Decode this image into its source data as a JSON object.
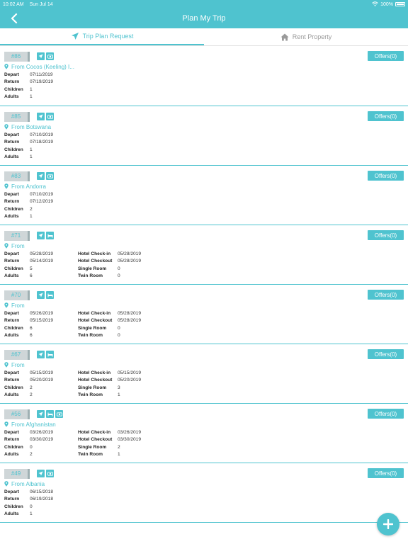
{
  "status_bar": {
    "time": "10:02 AM",
    "date": "Sun Jul 14",
    "battery": "100%"
  },
  "nav": {
    "title": "Plan My Trip"
  },
  "tabs": [
    {
      "label": "Trip Plan Request",
      "icon": "airplane-icon",
      "active": true
    },
    {
      "label": "Rent Property",
      "icon": "house-icon",
      "active": false
    }
  ],
  "labels": {
    "depart": "Depart",
    "return": "Return",
    "children": "Children",
    "adults": "Adults",
    "checkin": "Hotel Check-in",
    "checkout": "Hotel Checkout",
    "single": "Single Room",
    "twin": "Twin Room"
  },
  "colors": {
    "accent": "#4fc3cf",
    "badge_bg": "#cfd6d8"
  },
  "trips": [
    {
      "id": "#86",
      "services": [
        "flight",
        "tour"
      ],
      "offers": "Offers(0)",
      "from": "From Cocos (Keeling) I...",
      "depart": "07/11/2019",
      "return": "07/19/2019",
      "children": "1",
      "adults": "1"
    },
    {
      "id": "#85",
      "services": [
        "flight",
        "tour"
      ],
      "offers": "Offers(0)",
      "from": "From Botswana",
      "depart": "07/10/2019",
      "return": "07/18/2019",
      "children": "1",
      "adults": "1"
    },
    {
      "id": "#83",
      "services": [
        "flight",
        "tour"
      ],
      "offers": "Offers(0)",
      "from": "From Andorra",
      "depart": "07/10/2019",
      "return": "07/12/2019",
      "children": "2",
      "adults": "1"
    },
    {
      "id": "#71",
      "services": [
        "flight",
        "hotel"
      ],
      "offers": "Offers(0)",
      "from": "From",
      "depart": "05/28/2019",
      "return": "05/14/2019",
      "children": "5",
      "adults": "6",
      "checkin": "05/28/2019",
      "checkout": "05/28/2019",
      "single": "0",
      "twin": "0"
    },
    {
      "id": "#70",
      "services": [
        "flight",
        "hotel"
      ],
      "offers": "Offers(0)",
      "from": "From",
      "depart": "05/26/2019",
      "return": "05/15/2019",
      "children": "6",
      "adults": "6",
      "checkin": "05/28/2019",
      "checkout": "05/28/2019",
      "single": "0",
      "twin": "0"
    },
    {
      "id": "#67",
      "services": [
        "flight",
        "hotel"
      ],
      "offers": "Offers(0)",
      "from": "From",
      "depart": "05/15/2019",
      "return": "05/20/2019",
      "children": "2",
      "adults": "2",
      "checkin": "05/15/2019",
      "checkout": "05/20/2019",
      "single": "3",
      "twin": "1"
    },
    {
      "id": "#56",
      "services": [
        "flight",
        "hotel",
        "tour"
      ],
      "offers": "Offers(0)",
      "from": "From Afghanistan",
      "depart": "03/26/2019",
      "return": "03/30/2019",
      "children": "0",
      "adults": "2",
      "checkin": "03/26/2019",
      "checkout": "03/30/2019",
      "single": "2",
      "twin": "1"
    },
    {
      "id": "#49",
      "services": [
        "flight",
        "tour"
      ],
      "offers": "Offers(0)",
      "from": "From Albania",
      "depart": "06/15/2018",
      "return": "06/19/2018",
      "children": "0",
      "adults": "1"
    }
  ]
}
